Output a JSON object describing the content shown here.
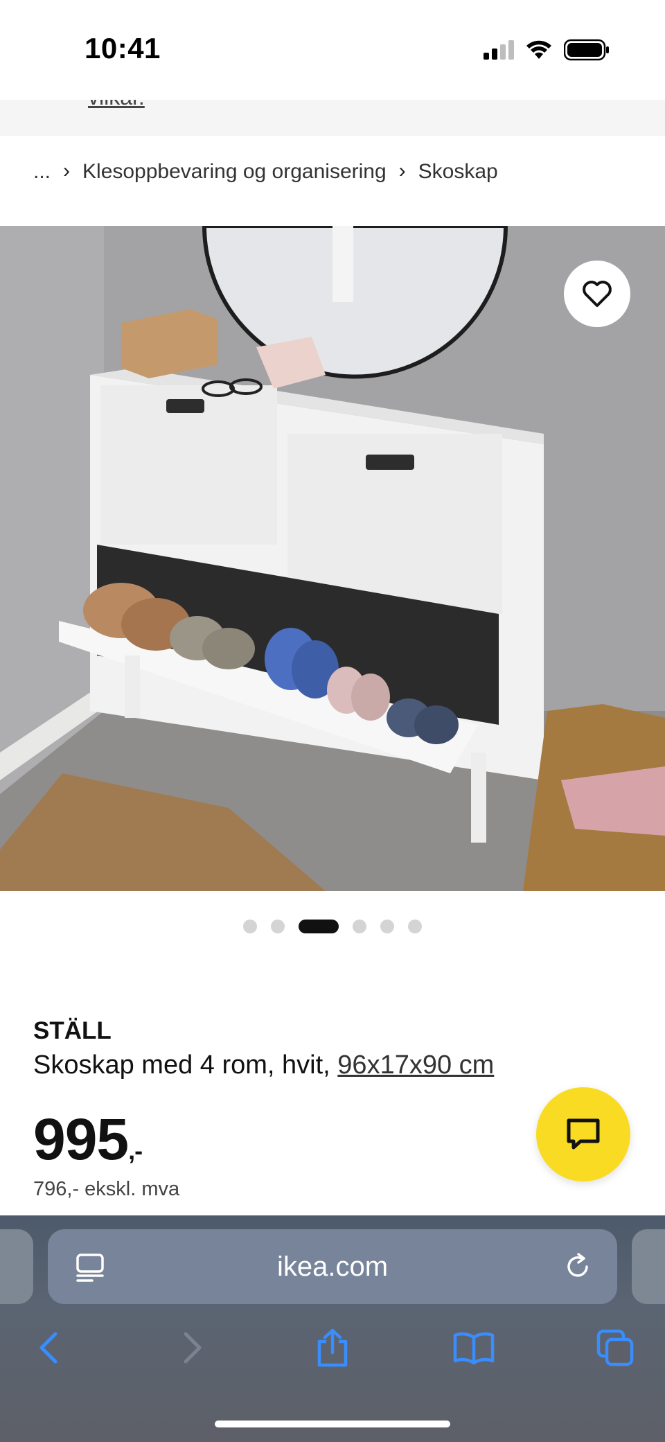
{
  "status_bar": {
    "time": "10:41",
    "icons": [
      "cellular-signal-icon",
      "wifi-icon",
      "battery-icon"
    ]
  },
  "banner": {
    "link_text": "vilkår."
  },
  "breadcrumb": {
    "items": [
      "...",
      "Klesoppbevaring og organisering",
      "Skoskap"
    ]
  },
  "product": {
    "image_alt": "STÄLL skoskap",
    "carousel": {
      "total": 6,
      "active_index": 2
    },
    "name": "STÄLL",
    "description_prefix": "Skoskap med 4 rom, hvit, ",
    "dimensions": "96x17x90 cm",
    "price_main": "995",
    "price_suffix": ",-",
    "price_ex_vat": "796,- ekskl. mva"
  },
  "browser": {
    "url": "ikea.com",
    "toolbar": [
      "back-icon",
      "forward-icon",
      "share-icon",
      "bookmarks-icon",
      "tabs-icon"
    ]
  },
  "colors": {
    "chat_button": "#fadb23",
    "safari_accent": "#3a8dfc",
    "active_dot": "#111111",
    "inactive_dot": "#d4d4d4"
  }
}
